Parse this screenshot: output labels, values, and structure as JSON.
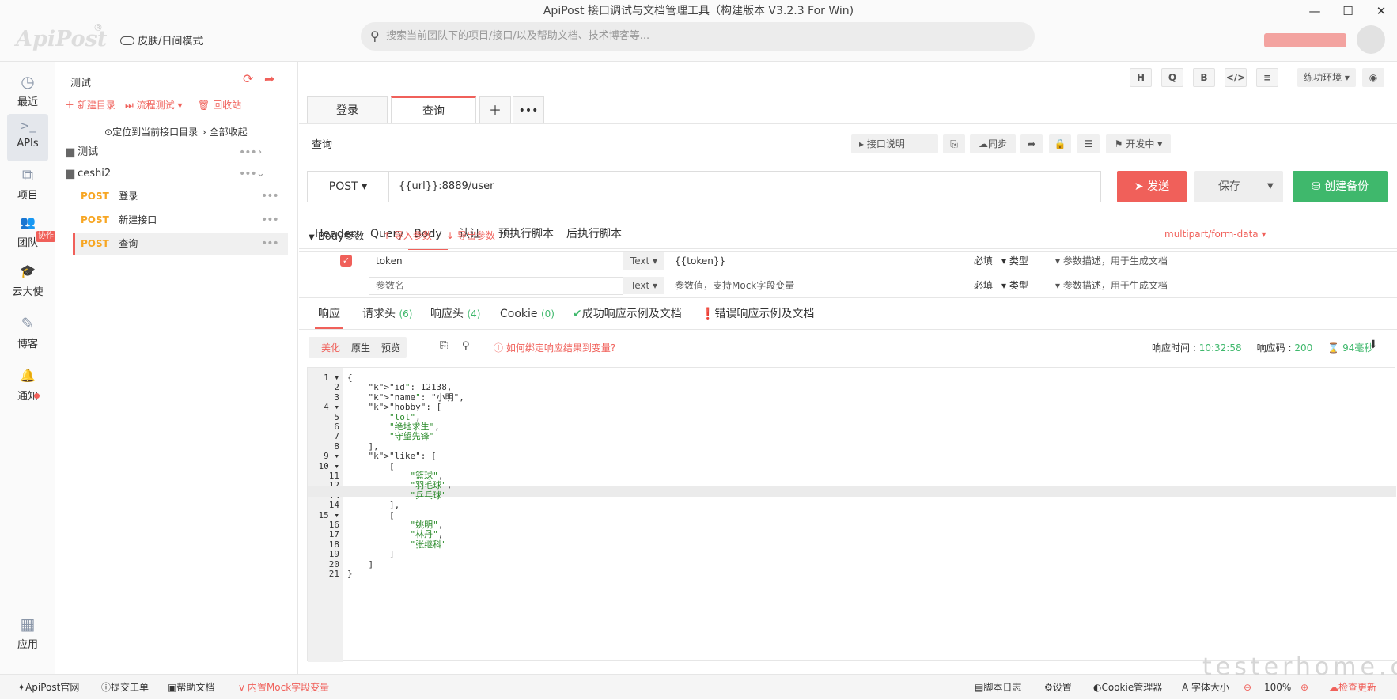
{
  "window": {
    "title": "ApiPost 接口调试与文档管理工具（构建版本 V3.2.3 For Win)"
  },
  "topbar": {
    "logo": "ApiPost",
    "reg_mark": "®",
    "skin_mode": "皮肤/日间模式",
    "search_placeholder": "搜索当前团队下的项目/接口/以及帮助文档、技术博客等..."
  },
  "sidebar": {
    "items": [
      {
        "label": "最近",
        "icon": "clock-icon",
        "glyph": "◷"
      },
      {
        "label": "APIs",
        "icon": "terminal-icon",
        "glyph": ">_"
      },
      {
        "label": "项目",
        "icon": "project-icon",
        "glyph": "⧉"
      },
      {
        "label": "团队",
        "icon": "team-icon",
        "glyph": "👥"
      },
      {
        "label": "云大使",
        "icon": "graduation-cap-icon",
        "glyph": "🎓"
      },
      {
        "label": "博客",
        "icon": "edit-icon",
        "glyph": "✎"
      },
      {
        "label": "通知",
        "icon": "bell-icon",
        "glyph": "🔔"
      },
      {
        "label": "应用",
        "icon": "grid-icon",
        "glyph": "▦"
      }
    ],
    "team_badge": "协作"
  },
  "tree": {
    "project": "测试",
    "new_folder": "新建目录",
    "flow_test": "流程测试",
    "recycle": "回收站",
    "locate": "定位到当前接口目录",
    "collapse": "全部收起",
    "folders": [
      {
        "name": "测试"
      },
      {
        "name": "ceshi2"
      }
    ],
    "apis": [
      {
        "method": "POST",
        "name": "登录"
      },
      {
        "method": "POST",
        "name": "新建接口"
      },
      {
        "method": "POST",
        "name": "查询"
      }
    ]
  },
  "toolbar": {
    "buttons": [
      "H",
      "Q",
      "B",
      "</>",
      "≡"
    ],
    "env": "练功环境"
  },
  "tabs": [
    {
      "label": "登录"
    },
    {
      "label": "查询"
    }
  ],
  "api": {
    "name": "查询",
    "doc_btn": "接口说明",
    "sync": "同步",
    "status": "开发中",
    "method": "POST",
    "url": "{{url}}:8889/user",
    "send": "发送",
    "save": "保存",
    "backup": "创建备份"
  },
  "request_tabs": [
    "Header",
    "Query",
    "Body",
    "认证",
    "预执行脚本",
    "后执行脚本"
  ],
  "body": {
    "title": "Body参数",
    "import": "导入参数",
    "export": "导出参数",
    "content_type": "multipart/form-data",
    "rows": [
      {
        "key": "token",
        "type": "Text",
        "value": "{{token}}",
        "required": "必填",
        "dtype": "类型",
        "desc": "参数描述，用于生成文档"
      },
      {
        "key": "参数名",
        "type": "Text",
        "value": "参数值，支持Mock字段变量",
        "required": "必填",
        "dtype": "类型",
        "desc": "参数描述，用于生成文档"
      }
    ]
  },
  "response_tabs": [
    {
      "label": "响应"
    },
    {
      "label": "请求头",
      "count": "(6)"
    },
    {
      "label": "响应头",
      "count": "(4)"
    },
    {
      "label": "Cookie",
      "count": "(0)"
    },
    {
      "label": "成功响应示例及文档"
    },
    {
      "label": "错误响应示例及文档"
    }
  ],
  "response": {
    "views": [
      "美化",
      "原生",
      "预览"
    ],
    "bind_hint": "如何绑定响应结果到变量?",
    "time_label": "响应时间 :",
    "time": "10:32:58",
    "code_label": "响应码 :",
    "code": "200",
    "duration": "94毫秒"
  },
  "code_lines": [
    "{",
    "    \"id\": 12138,",
    "    \"name\": \"小明\",",
    "    \"hobby\": [",
    "        \"lol\",",
    "        \"绝地求生\",",
    "        \"守望先锋\"",
    "    ],",
    "    \"like\": [",
    "        [",
    "            \"篮球\",",
    "            \"羽毛球\",",
    "            \"乒乓球\"",
    "        ],",
    "        [",
    "            \"姚明\",",
    "            \"林丹\",",
    "            \"张继科\"",
    "        ]",
    "    ]",
    "}"
  ],
  "statusbar": {
    "left": [
      "ApiPost官网",
      "提交工单",
      "帮助文档",
      "内置Mock字段变量"
    ],
    "right": [
      "脚本日志",
      "设置",
      "Cookie管理器",
      "字体大小"
    ],
    "zoom": "100%",
    "update": "检查更新"
  },
  "watermark": "testerhome.com"
}
